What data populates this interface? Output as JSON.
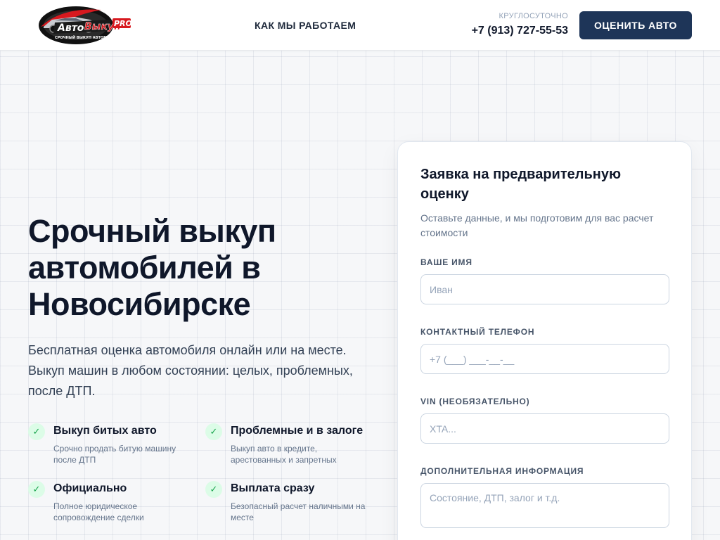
{
  "header": {
    "logo": {
      "brand_auto": "Авто",
      "brand_vykup": "Выкуп",
      "brand_pro": "PRO",
      "tagline": "СРОЧНЫЙ ВЫКУП АВТОМОБИЛЕЙ"
    },
    "nav_link": "КАК МЫ РАБОТАЕМ",
    "phone_note": "КРУГЛОСУТОЧНО",
    "phone": "+7 (913) 727-55-53",
    "cta_label": "ОЦЕНИТЬ АВТО"
  },
  "hero": {
    "title": "Срочный выкуп автомобилей в Новосибирске",
    "subtitle": "Бесплатная оценка автомобиля онлайн или на месте. Выкуп машин в любом состоянии: целых, проблемных, после ДТП.",
    "features": [
      {
        "title": "Выкуп битых авто",
        "text": "Срочно продать битую машину после ДТП"
      },
      {
        "title": "Проблемные и в залоге",
        "text": "Выкуп авто в кредите, арестованных и запретных"
      },
      {
        "title": "Официально",
        "text": "Полное юридическое сопровождение сделки"
      },
      {
        "title": "Выплата сразу",
        "text": "Безопасный расчет наличными на месте"
      }
    ],
    "check_icon": "✓"
  },
  "form": {
    "title": "Заявка на предварительную оценку",
    "subtitle": "Оставьте данные, и мы подготовим для вас расчет стоимости",
    "fields": {
      "name": {
        "label": "ВАШЕ ИМЯ",
        "value": "",
        "placeholder": "Иван"
      },
      "phone": {
        "label": "КОНТАКТНЫЙ ТЕЛЕФОН",
        "value": "",
        "placeholder": "+7 (___) ___-__-__"
      },
      "vin": {
        "label": "VIN (НЕОБЯЗАТЕЛЬНО)",
        "value": "",
        "placeholder": "XTA..."
      },
      "info": {
        "label": "ДОПОЛНИТЕЛЬНАЯ ИНФОРМАЦИЯ",
        "value": "",
        "placeholder": "Состояние, ДТП, залог и т.д."
      }
    }
  },
  "colors": {
    "primary": "#1e3558",
    "accent_red": "#d7191f",
    "check_green": "#16a34a",
    "check_bg": "#dcfce7"
  },
  "icons": {
    "logo": "car-logo-icon",
    "feature_check": "check-icon"
  }
}
